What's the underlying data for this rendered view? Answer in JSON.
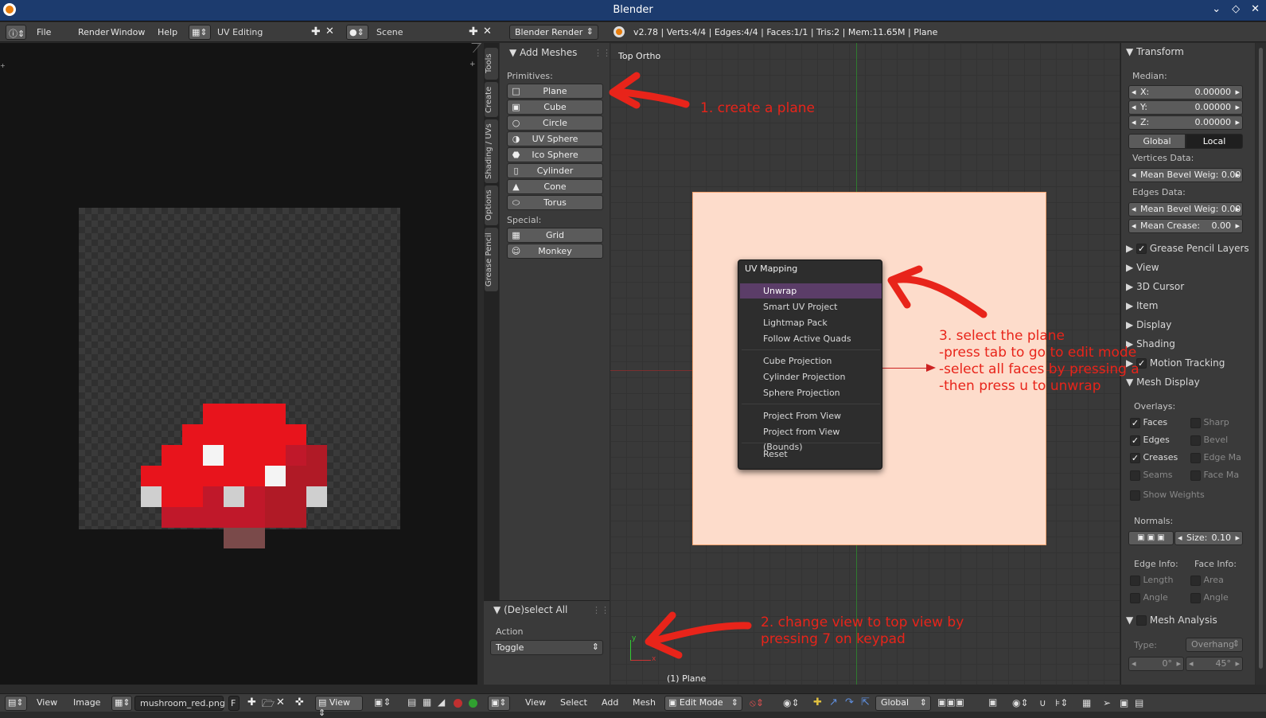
{
  "window": {
    "title": "Blender"
  },
  "topbar": {
    "menus": [
      "File",
      "Render",
      "Window",
      "Help"
    ],
    "screen_layout": "UV Editing",
    "scene": "Scene",
    "render_engine": "Blender Render",
    "stats": "v2.78 | Verts:4/4 | Edges:4/4 | Faces:1/1 | Tris:2 | Mem:11.65M | Plane"
  },
  "tool_tabs": [
    "Tools",
    "Create",
    "Shading / UVs",
    "Options",
    "Grease Pencil"
  ],
  "toolshelf": {
    "header": "Add Meshes",
    "primitives_label": "Primitives:",
    "primitives": [
      "Plane",
      "Cube",
      "Circle",
      "UV Sphere",
      "Ico Sphere",
      "Cylinder",
      "Cone",
      "Torus"
    ],
    "special_label": "Special:",
    "special": [
      "Grid",
      "Monkey"
    ]
  },
  "operator_panel": {
    "header": "(De)select All",
    "action_label": "Action",
    "action_value": "Toggle"
  },
  "viewport": {
    "view_name": "Top Ortho",
    "object_label": "(1) Plane"
  },
  "uv_menu": {
    "title": "UV Mapping",
    "items": [
      "Unwrap",
      "Smart UV Project",
      "Lightmap Pack",
      "Follow Active Quads",
      "Cube Projection",
      "Cylinder Projection",
      "Sphere Projection",
      "Project From View",
      "Project from View (Bounds)",
      "Reset"
    ]
  },
  "properties": {
    "transform_header": "Transform",
    "median_label": "Median:",
    "x": {
      "label": "X:",
      "value": "0.00000"
    },
    "y": {
      "label": "Y:",
      "value": "0.00000"
    },
    "z": {
      "label": "Z:",
      "value": "0.00000"
    },
    "global_label": "Global",
    "local_label": "Local",
    "vertices_data_label": "Vertices Data:",
    "mean_bevel_vert": "Mean Bevel Weig: 0.00",
    "edges_data_label": "Edges Data:",
    "mean_bevel_edge": "Mean Bevel Weig: 0.00",
    "mean_crease_label": "Mean Crease:",
    "mean_crease_value": "0.00",
    "sections": [
      "Grease Pencil Layers",
      "View",
      "3D Cursor",
      "Item",
      "Display",
      "Shading",
      "Motion Tracking",
      "Mesh Display"
    ],
    "overlays_label": "Overlays:",
    "overlays_left": [
      {
        "label": "Faces",
        "checked": true
      },
      {
        "label": "Edges",
        "checked": true
      },
      {
        "label": "Creases",
        "checked": true
      },
      {
        "label": "Seams",
        "checked": false
      }
    ],
    "overlays_right": [
      {
        "label": "Sharp",
        "checked": false
      },
      {
        "label": "Bevel",
        "checked": false
      },
      {
        "label": "Edge Ma",
        "checked": false
      },
      {
        "label": "Face Ma",
        "checked": false
      }
    ],
    "show_weights": "Show Weights",
    "normals_label": "Normals:",
    "size_label": "Size:",
    "size_value": "0.10",
    "edge_info_label": "Edge Info:",
    "face_info_label": "Face Info:",
    "edge_info": [
      "Length",
      "Angle"
    ],
    "face_info": [
      "Area",
      "Angle"
    ],
    "mesh_analysis": "Mesh Analysis",
    "type_label": "Type:",
    "type_value": "Overhang",
    "angle_min": "0°",
    "angle_max": "45°"
  },
  "bottombar": {
    "uv_menus": [
      "View",
      "Image"
    ],
    "image_name": "mushroom_red.png",
    "image_f": "F",
    "uv_view": "View",
    "view3d_menus": [
      "View",
      "Select",
      "Add",
      "Mesh"
    ],
    "mode": "Edit Mode",
    "orientation": "Global"
  },
  "annotations": {
    "a1": "1. create a plane",
    "a2_line1": "2. change view to top view by",
    "a2_line2": "pressing 7 on keypad",
    "a3_line1": "3. select the plane",
    "a3_line2": "-press tab to go to edit mode",
    "a3_line3": "-select all faces by pressing a",
    "a3_line4": "-then press u to unwrap"
  },
  "colors": {
    "accent": "#5b3d68",
    "annotation": "#e8241a",
    "title_bar": "#1c3b6e",
    "plane": "#fddccb"
  }
}
